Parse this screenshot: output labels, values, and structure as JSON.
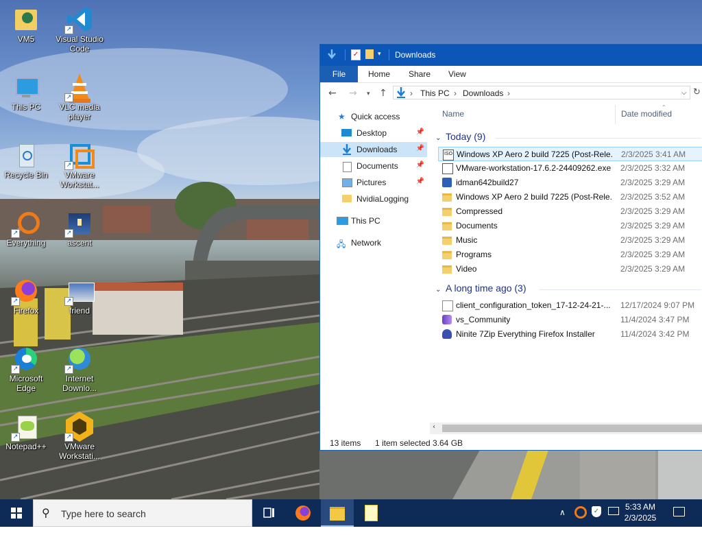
{
  "desktop": {
    "icons": [
      {
        "label": "VM5",
        "icon": "user-folder-icon"
      },
      {
        "label": "Visual Studio Code",
        "icon": "vscode-icon"
      },
      {
        "label": "This PC",
        "icon": "computer-icon"
      },
      {
        "label": "VLC media player",
        "icon": "vlc-icon"
      },
      {
        "label": "Recycle Bin",
        "icon": "recycle-bin-icon"
      },
      {
        "label": "VMware Workstat...",
        "icon": "vmware-icon"
      },
      {
        "label": "Everything",
        "icon": "everything-search-icon"
      },
      {
        "label": "ascent",
        "icon": "ascent-image-icon"
      },
      {
        "label": "Firefox",
        "icon": "firefox-icon"
      },
      {
        "label": "friend",
        "icon": "friend-image-icon"
      },
      {
        "label": "Microsoft Edge",
        "icon": "edge-icon"
      },
      {
        "label": "Internet Downlo...",
        "icon": "idm-icon"
      },
      {
        "label": "Notepad++",
        "icon": "notepadpp-icon"
      },
      {
        "label": "VMware Workstati...",
        "icon": "vmware-workstation-icon"
      }
    ]
  },
  "explorer": {
    "title": "Downloads",
    "ribbon_tabs": [
      "File",
      "Home",
      "Share",
      "View"
    ],
    "address": {
      "segments": [
        "This PC",
        "Downloads"
      ]
    },
    "nav": {
      "quick_access": "Quick access",
      "pinned": [
        "Desktop",
        "Downloads",
        "Documents",
        "Pictures"
      ],
      "other": "NvidiaLogging",
      "this_pc": "This PC",
      "network": "Network"
    },
    "columns": {
      "name": "Name",
      "date": "Date modified"
    },
    "groups": [
      {
        "header": "Today (9)"
      },
      {
        "header": "A long time ago (3)"
      }
    ],
    "files": [
      {
        "name": "Windows XP Aero 2 build 7225 (Post-Rele...",
        "date": "2/3/2025 3:41 AM",
        "icon": "iso-file-icon"
      },
      {
        "name": "VMware-workstation-17.6.2-24409262.exe",
        "date": "2/3/2025 3:32 AM",
        "icon": "installer-exe-icon"
      },
      {
        "name": "idman642build27",
        "date": "2/3/2025 3:29 AM",
        "icon": "idm-installer-icon"
      },
      {
        "name": "Windows XP Aero 2 build 7225 (Post-Rele...",
        "date": "2/3/2025 3:52 AM",
        "icon": "folder-icon"
      },
      {
        "name": "Compressed",
        "date": "2/3/2025 3:29 AM",
        "icon": "folder-icon"
      },
      {
        "name": "Documents",
        "date": "2/3/2025 3:29 AM",
        "icon": "folder-icon"
      },
      {
        "name": "Music",
        "date": "2/3/2025 3:29 AM",
        "icon": "folder-icon"
      },
      {
        "name": "Programs",
        "date": "2/3/2025 3:29 AM",
        "icon": "folder-icon"
      },
      {
        "name": "Video",
        "date": "2/3/2025 3:29 AM",
        "icon": "folder-icon"
      },
      {
        "name": "client_configuration_token_17-12-24-21-...",
        "date": "12/17/2024 9:07 PM",
        "icon": "document-file-icon"
      },
      {
        "name": "vs_Community",
        "date": "11/4/2024 3:47 PM",
        "icon": "visual-studio-installer-icon"
      },
      {
        "name": "Ninite 7Zip Everything Firefox Installer",
        "date": "11/4/2024 3:42 PM",
        "icon": "ninite-icon"
      }
    ],
    "status": {
      "items": "13 items",
      "selected": "1 item selected",
      "size": "3.64 GB"
    }
  },
  "taskbar": {
    "search_placeholder": "Type here to search",
    "time": "5:33 AM",
    "date": "2/3/2025"
  }
}
